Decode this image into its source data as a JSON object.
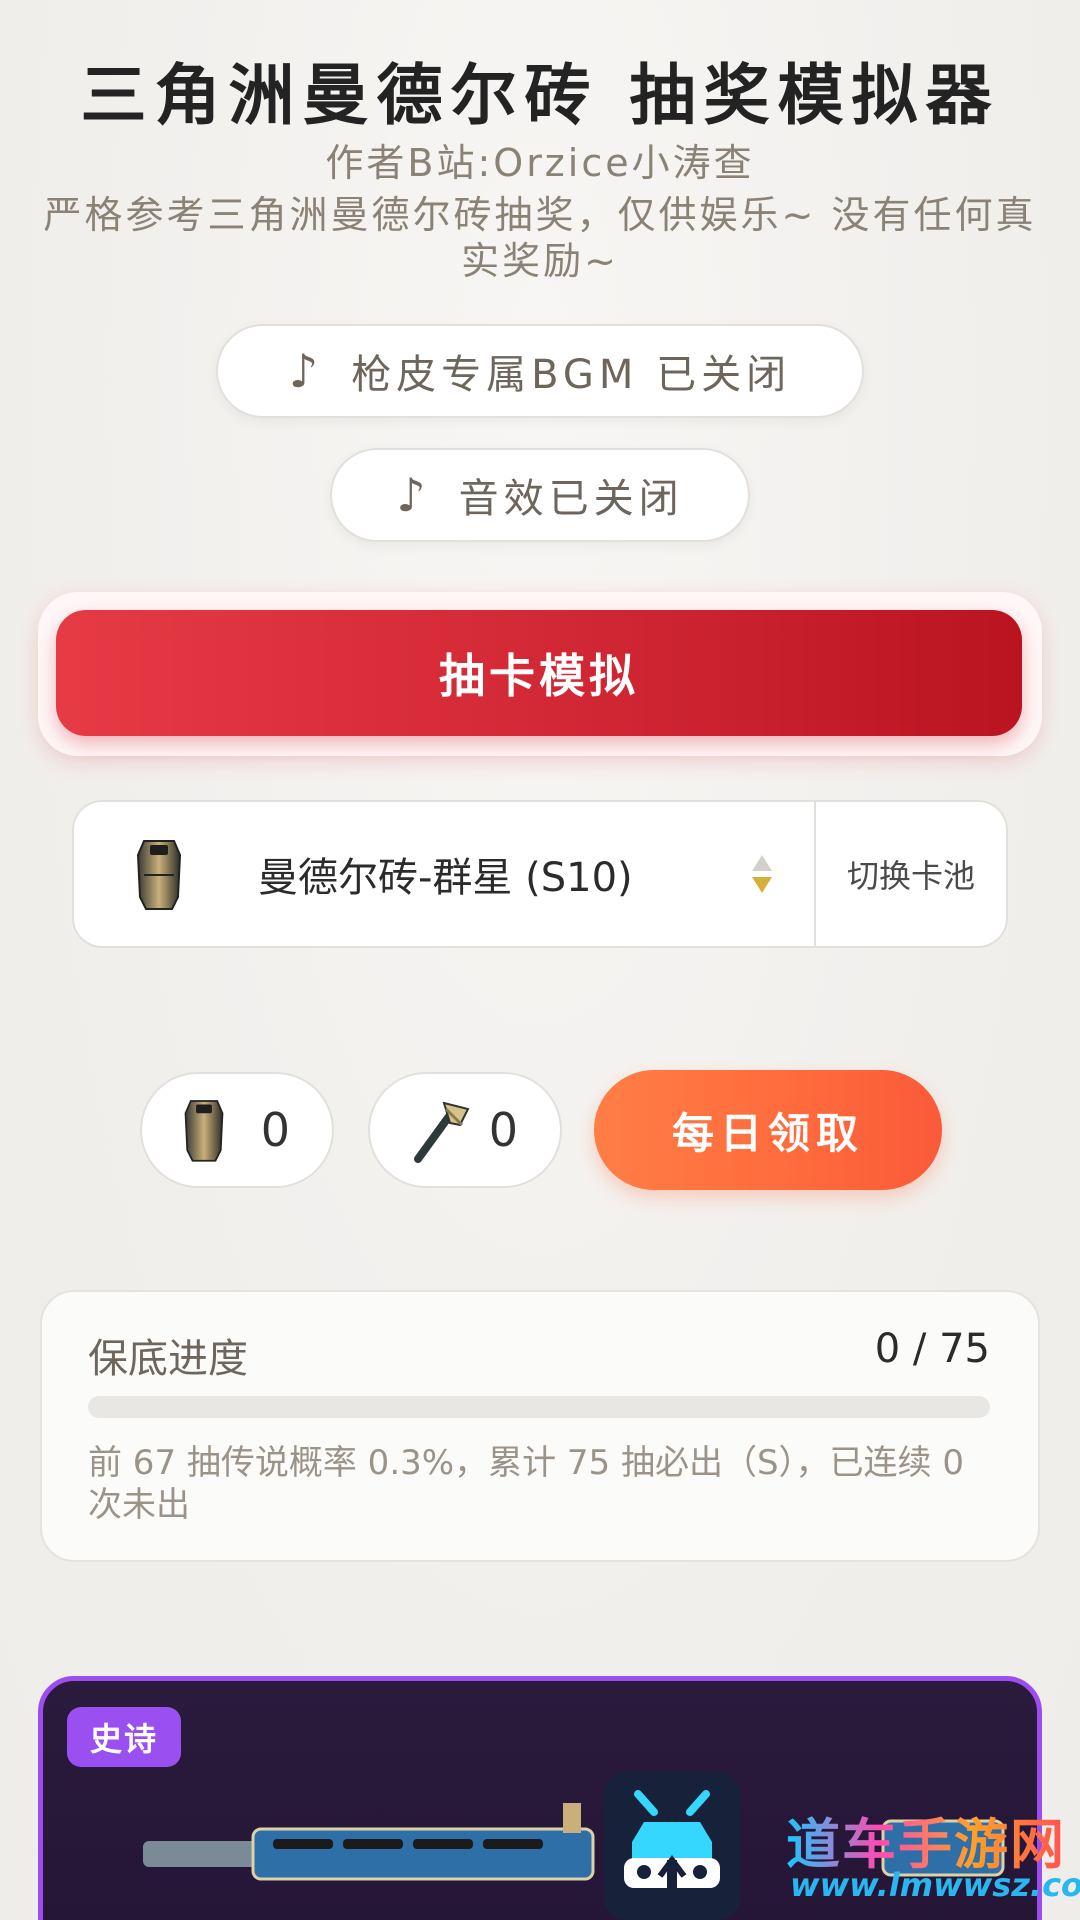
{
  "header": {
    "title": "三角洲曼德尔砖 抽奖模拟器",
    "author": "作者B站:Orzice小涛查",
    "description": "严格参考三角洲曼德尔砖抽奖，仅供娱乐~ 没有任何真实奖励~"
  },
  "toggles": {
    "bgm_label": "枪皮专属BGM 已关闭",
    "sfx_label": "音效已关闭",
    "note_icon": "♪"
  },
  "actions": {
    "draw_label": "抽卡模拟",
    "daily_label": "每日领取"
  },
  "pool": {
    "selected": "曼德尔砖-群星 (S10)",
    "switch_label": "切换卡池"
  },
  "inventory": {
    "brick_count": "0",
    "key_count": "0"
  },
  "pity": {
    "label": "保底进度",
    "current": 0,
    "max": 75,
    "count_text": "0 / 75",
    "note": "前 67 抽传说概率 0.3%，累计 75 抽必出（S），已连续 0 次未出"
  },
  "result": {
    "rarity": "史诗"
  },
  "watermark": {
    "site": "道车手游网",
    "url": "www.lmwwsz.com"
  },
  "colors": {
    "draw_button": "#d42a36",
    "daily_button": "#ff6c3d",
    "epic_purple": "#9a4ff0",
    "text_muted": "#8b8276"
  }
}
